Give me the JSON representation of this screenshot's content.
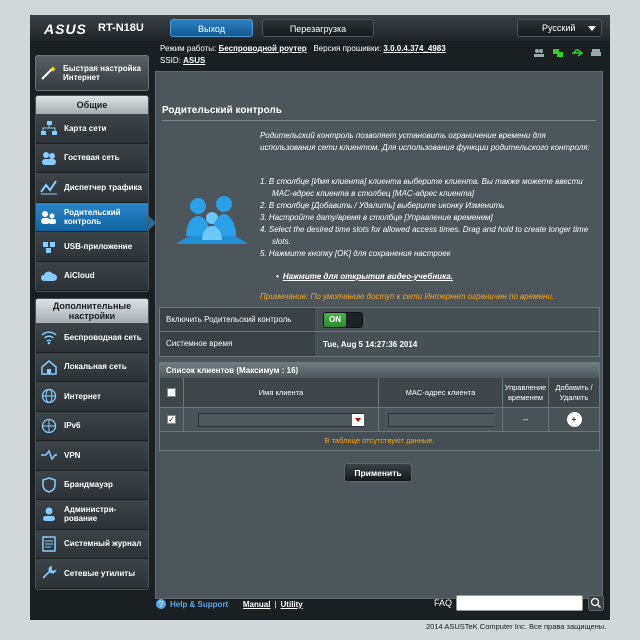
{
  "header": {
    "brand": "ASUS",
    "model": "RT-N18U",
    "logout": "Выход",
    "reboot": "Перезагрузка",
    "language": "Русский"
  },
  "info": {
    "mode_label": "Режим работы:",
    "mode_value": "Беспроводной роутер",
    "fw_label": "Версия прошивки:",
    "fw_value": "3.0.0.4.374_4983",
    "ssid_label": "SSID:",
    "ssid_value": "ASUS"
  },
  "sidebar": {
    "quick_setup": "Быстрая настройка Интернет",
    "general_title": "Общие",
    "general_items": [
      {
        "label": "Карта сети",
        "icon": "network-map-icon"
      },
      {
        "label": "Гостевая сеть",
        "icon": "guest-network-icon"
      },
      {
        "label": "Диспетчер трафика",
        "icon": "traffic-manager-icon"
      },
      {
        "label": "Родительский контроль",
        "icon": "parental-control-icon"
      },
      {
        "label": "USB-приложение",
        "icon": "usb-app-icon"
      },
      {
        "label": "AiCloud",
        "icon": "aicloud-icon"
      }
    ],
    "advanced_title": "Дополнительные настройки",
    "advanced_items": [
      {
        "label": "Беспроводная сеть",
        "icon": "wireless-icon"
      },
      {
        "label": "Локальная сеть",
        "icon": "lan-icon"
      },
      {
        "label": "Интернет",
        "icon": "internet-icon"
      },
      {
        "label": "IPv6",
        "icon": "ipv6-icon"
      },
      {
        "label": "VPN",
        "icon": "vpn-icon"
      },
      {
        "label": "Брандмауэр",
        "icon": "firewall-icon"
      },
      {
        "label": "Администри-рование",
        "icon": "administration-icon"
      },
      {
        "label": "Системный журнал",
        "icon": "system-log-icon"
      },
      {
        "label": "Сетевые утилиты",
        "icon": "network-tools-icon"
      }
    ]
  },
  "content": {
    "title": "Родительский контроль",
    "description": "Родительский контроль позволяет установить ограничение времени для использования сети клиентом. Для использования функции родительского контроля:",
    "steps": [
      "1.  В столбце [Имя клиента] клиента выберите клиента. Вы также можете ввести MAC-адрес клиента в столбец [MAC-адрес клиента]",
      "2.  В столбце [Добавить / Удалить] выберите иконку Изменить",
      "3.  Настройте дату/время в столбце [Управление временем]",
      "4.  Select the desired time slots for allowed access times. Drag and hold to create longer time slots.",
      "5.  Нажмите кнопку [OK] для сохранения настроек"
    ],
    "video_link": "Нажмите для открытия видео-учебника.",
    "note": "Примечание: По умолчанию доступ к сети Интернет ограничен по времени.",
    "enable_label": "Включить Родительский контроль",
    "toggle_on": "ON",
    "systime_label": "Системное время",
    "systime_value": "Tue, Aug 5  14:27:36 2014",
    "client_list_title": "Список клиентов (Максимум : 16)",
    "columns": {
      "name": "Имя клиента",
      "mac": "MAC-адрес клиента",
      "time": "Управление временем",
      "add": "Добавить / Удалить"
    },
    "time_placeholder": "--",
    "empty_msg": "В таблице отсутствуют данные.",
    "apply": "Применить"
  },
  "footer": {
    "help": "Help & Support",
    "manual": "Manual",
    "sep": "|",
    "utility": "Utility",
    "faq": "FAQ",
    "copyright": "2014  ASUSTeK Computer Inc. Все права защищены."
  },
  "colors": {
    "accent": "#1c6aa6",
    "note": "#f5a623",
    "on": "#49b34a"
  }
}
